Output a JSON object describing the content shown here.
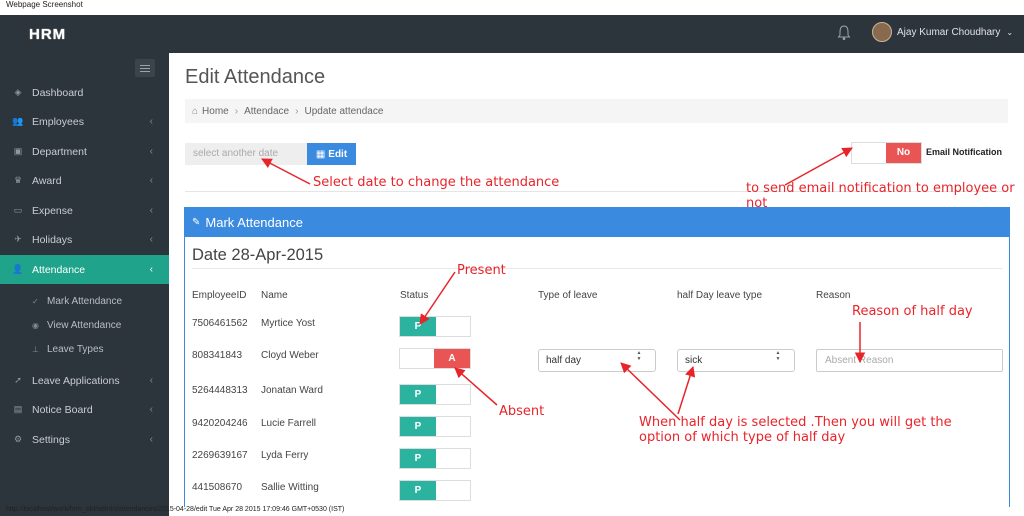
{
  "caption": "Webpage Screenshot",
  "status_url": "http://localhost/work/hrm_old/admin/attendances/2015-04-28/edit Tue Apr 28 2015 17:09:46 GMT+0530 (IST)",
  "topbar": {
    "brand": "HRM",
    "user_name": "Ajay Kumar Choudhary",
    "caret": "⌄",
    "icons": [
      "bell-icon",
      "avatar"
    ]
  },
  "sidebar": {
    "items": [
      {
        "label": "Dashboard",
        "icon": "dashboard-icon",
        "glyph": "◈",
        "chevron": ""
      },
      {
        "label": "Employees",
        "icon": "users-icon",
        "glyph": "👥",
        "chevron": "‹"
      },
      {
        "label": "Department",
        "icon": "briefcase-icon",
        "glyph": "▣",
        "chevron": "‹"
      },
      {
        "label": "Award",
        "icon": "trophy-icon",
        "glyph": "♛",
        "chevron": "‹"
      },
      {
        "label": "Expense",
        "icon": "money-icon",
        "glyph": "▭",
        "chevron": "‹"
      },
      {
        "label": "Holidays",
        "icon": "plane-icon",
        "glyph": "✈",
        "chevron": "‹"
      },
      {
        "label": "Attendance",
        "icon": "user-icon",
        "glyph": "👤",
        "chevron": "‹"
      },
      {
        "label": "Leave Applications",
        "icon": "rocket-icon",
        "glyph": "➚",
        "chevron": "‹"
      },
      {
        "label": "Notice Board",
        "icon": "clipboard-icon",
        "glyph": "▤",
        "chevron": "‹"
      },
      {
        "label": "Settings",
        "icon": "gears-icon",
        "glyph": "⚙",
        "chevron": "‹"
      }
    ],
    "sub_items": [
      {
        "label": "Mark Attendance",
        "icon": "check-icon",
        "glyph": "✓"
      },
      {
        "label": "View Attendance",
        "icon": "eye-icon",
        "glyph": "◉"
      },
      {
        "label": "Leave Types",
        "icon": "sitemap-icon",
        "glyph": "⊥"
      }
    ],
    "active_color": "#1fa38a"
  },
  "main": {
    "title": "Edit Attendance",
    "breadcrumb": [
      "Home",
      "Attendace",
      "Update attendace"
    ],
    "breadcrumb_home_icon": "⌂",
    "breadcrumb_sep": "›",
    "date_placeholder": "select another date",
    "edit_button": "Edit",
    "edit_icon": "▦",
    "email_toggle_value": "No",
    "email_label": "Email Notification"
  },
  "panel": {
    "title": "Mark Attendance",
    "title_icon": "✎",
    "date_heading": "Date 28-Apr-2015",
    "columns": [
      "EmployeeID",
      "Name",
      "Status",
      "Type of leave",
      "half Day leave type",
      "Reason"
    ],
    "rows": [
      {
        "id": "7506461562",
        "name": "Myrtice Yost",
        "status": "P"
      },
      {
        "id": "808341843",
        "name": "Cloyd Weber",
        "status": "A",
        "leave_type": "half day",
        "half_day_type": "sick",
        "reason_placeholder": "Absent Reason"
      },
      {
        "id": "5264448313",
        "name": "Jonatan Ward",
        "status": "P"
      },
      {
        "id": "9420204246",
        "name": "Lucie Farrell",
        "status": "P"
      },
      {
        "id": "2269639167",
        "name": "Lyda Ferry",
        "status": "P"
      },
      {
        "id": "441508670",
        "name": "Sallie Witting",
        "status": "P"
      }
    ],
    "select_arrow": "▲▼",
    "colors": {
      "present": "#2bb3a0",
      "absent": "#e95454",
      "header": "#3a8be0"
    }
  },
  "annotations": {
    "select_date": "Select date to change the attendance",
    "email": "to send email notification to employee or not",
    "present": "Present",
    "absent": "Absent",
    "reason": "Reason of half day",
    "half_day": "When half day is selected .Then you will get the option of which type of half day",
    "color": "#e8242a"
  }
}
